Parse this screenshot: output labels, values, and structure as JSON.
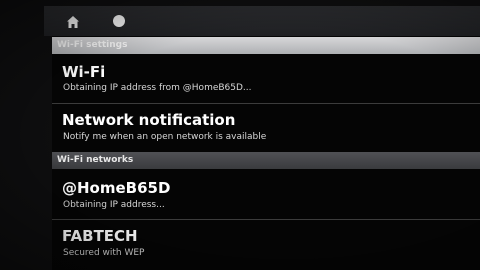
{
  "statusbar": {
    "icons": [
      "home-icon",
      "circle-icon"
    ]
  },
  "header": {
    "wifi_settings": "Wi-Fi settings"
  },
  "wifi": {
    "title": "Wi-Fi",
    "status": "Obtaining IP address from @HomeB65D..."
  },
  "network_notification": {
    "title": "Network notification",
    "description": "Notify me when an open network is available"
  },
  "networks_header": "Wi-Fi networks",
  "networks": [
    {
      "ssid": "@HomeB65D",
      "status": "Obtaining IP address..."
    },
    {
      "ssid": "FABTECH",
      "status": "Secured with WEP"
    }
  ],
  "colors": {
    "header_light": "#c4c5c8",
    "header_dark": "#45464a",
    "background": "#050505",
    "text": "#ffffff"
  }
}
